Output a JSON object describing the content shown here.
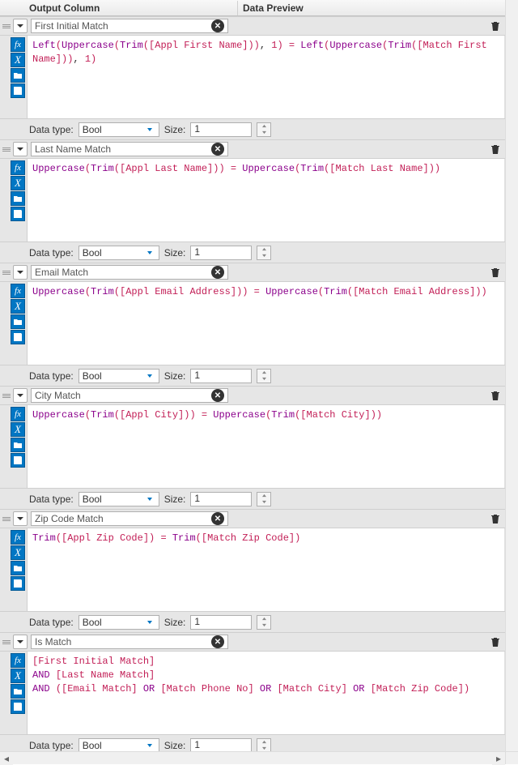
{
  "headers": {
    "output": "Output Column",
    "preview": "Data Preview"
  },
  "labels": {
    "data_type": "Data type:",
    "size": "Size:"
  },
  "rows": [
    {
      "name": "First Initial Match",
      "data_type": "Bool",
      "size": "1",
      "expression_plain": "Left(Uppercase(Trim([Appl First Name])), 1) = Left(Uppercase(Trim([Match First Name])), 1)",
      "expression_tokens": [
        {
          "t": "Left",
          "c": "tok-fn"
        },
        {
          "t": "(",
          "c": "tok-lit"
        },
        {
          "t": "Uppercase",
          "c": "tok-fn"
        },
        {
          "t": "(",
          "c": "tok-lit"
        },
        {
          "t": "Trim",
          "c": "tok-fn"
        },
        {
          "t": "(",
          "c": "tok-lit"
        },
        {
          "t": "[Appl First Name]",
          "c": "tok-field2"
        },
        {
          "t": ")",
          "c": "tok-lit"
        },
        {
          "t": ")",
          "c": "tok-lit"
        },
        {
          "t": ", ",
          "c": ""
        },
        {
          "t": "1",
          "c": "tok-lit"
        },
        {
          "t": ")",
          "c": "tok-lit"
        },
        {
          "t": " = ",
          "c": "tok-lit"
        },
        {
          "t": "Left",
          "c": "tok-fn"
        },
        {
          "t": "(",
          "c": "tok-lit"
        },
        {
          "t": "Uppercase",
          "c": "tok-fn"
        },
        {
          "t": "(",
          "c": "tok-lit"
        },
        {
          "t": "Trim",
          "c": "tok-fn"
        },
        {
          "t": "(",
          "c": "tok-lit"
        },
        {
          "t": "[Match First Name]",
          "c": "tok-field2"
        },
        {
          "t": ")",
          "c": "tok-lit"
        },
        {
          "t": ")",
          "c": "tok-lit"
        },
        {
          "t": ", ",
          "c": ""
        },
        {
          "t": "1",
          "c": "tok-lit"
        },
        {
          "t": ")",
          "c": "tok-lit"
        }
      ]
    },
    {
      "name": "Last Name Match",
      "data_type": "Bool",
      "size": "1",
      "expression_plain": "Uppercase(Trim([Appl Last Name])) = Uppercase(Trim([Match Last Name]))",
      "expression_tokens": [
        {
          "t": "Uppercase",
          "c": "tok-fn"
        },
        {
          "t": "(",
          "c": "tok-lit"
        },
        {
          "t": "Trim",
          "c": "tok-fn"
        },
        {
          "t": "(",
          "c": "tok-lit"
        },
        {
          "t": "[Appl Last Name]",
          "c": "tok-field2"
        },
        {
          "t": ")",
          "c": "tok-lit"
        },
        {
          "t": ")",
          "c": "tok-lit"
        },
        {
          "t": " = ",
          "c": "tok-lit"
        },
        {
          "t": "Uppercase",
          "c": "tok-fn"
        },
        {
          "t": "(",
          "c": "tok-lit"
        },
        {
          "t": "Trim",
          "c": "tok-fn"
        },
        {
          "t": "(",
          "c": "tok-lit"
        },
        {
          "t": "[Match Last Name]",
          "c": "tok-field2"
        },
        {
          "t": ")",
          "c": "tok-lit"
        },
        {
          "t": ")",
          "c": "tok-lit"
        }
      ]
    },
    {
      "name": "Email Match",
      "data_type": "Bool",
      "size": "1",
      "expression_plain": "Uppercase(Trim([Appl Email Address])) = Uppercase(Trim([Match Email Address]))",
      "expression_tokens": [
        {
          "t": "Uppercase",
          "c": "tok-fn"
        },
        {
          "t": "(",
          "c": "tok-lit"
        },
        {
          "t": "Trim",
          "c": "tok-fn"
        },
        {
          "t": "(",
          "c": "tok-lit"
        },
        {
          "t": "[Appl Email Address]",
          "c": "tok-field2"
        },
        {
          "t": ")",
          "c": "tok-lit"
        },
        {
          "t": ")",
          "c": "tok-lit"
        },
        {
          "t": " = ",
          "c": "tok-lit"
        },
        {
          "t": "Uppercase",
          "c": "tok-fn"
        },
        {
          "t": "(",
          "c": "tok-lit"
        },
        {
          "t": "Trim",
          "c": "tok-fn"
        },
        {
          "t": "(",
          "c": "tok-lit"
        },
        {
          "t": "[Match Email Address]",
          "c": "tok-field2"
        },
        {
          "t": ")",
          "c": "tok-lit"
        },
        {
          "t": ")",
          "c": "tok-lit"
        }
      ]
    },
    {
      "name": "City Match",
      "data_type": "Bool",
      "size": "1",
      "expression_plain": "Uppercase(Trim([Appl City])) = Uppercase(Trim([Match City]))",
      "expression_tokens": [
        {
          "t": "Uppercase",
          "c": "tok-fn"
        },
        {
          "t": "(",
          "c": "tok-lit"
        },
        {
          "t": "Trim",
          "c": "tok-fn"
        },
        {
          "t": "(",
          "c": "tok-lit"
        },
        {
          "t": "[Appl City]",
          "c": "tok-field2"
        },
        {
          "t": ")",
          "c": "tok-lit"
        },
        {
          "t": ")",
          "c": "tok-lit"
        },
        {
          "t": " = ",
          "c": "tok-lit"
        },
        {
          "t": "Uppercase",
          "c": "tok-fn"
        },
        {
          "t": "(",
          "c": "tok-lit"
        },
        {
          "t": "Trim",
          "c": "tok-fn"
        },
        {
          "t": "(",
          "c": "tok-lit"
        },
        {
          "t": "[Match City]",
          "c": "tok-field2"
        },
        {
          "t": ")",
          "c": "tok-lit"
        },
        {
          "t": ")",
          "c": "tok-lit"
        }
      ]
    },
    {
      "name": "Zip Code Match",
      "data_type": "Bool",
      "size": "1",
      "expression_plain": "Trim([Appl Zip Code]) = Trim([Match Zip Code])",
      "expression_tokens": [
        {
          "t": "Trim",
          "c": "tok-fn"
        },
        {
          "t": "(",
          "c": "tok-lit"
        },
        {
          "t": "[Appl Zip Code]",
          "c": "tok-field2"
        },
        {
          "t": ")",
          "c": "tok-lit"
        },
        {
          "t": " = ",
          "c": "tok-lit"
        },
        {
          "t": "Trim",
          "c": "tok-fn"
        },
        {
          "t": "(",
          "c": "tok-lit"
        },
        {
          "t": "[Match Zip Code]",
          "c": "tok-field2"
        },
        {
          "t": ")",
          "c": "tok-lit"
        }
      ]
    },
    {
      "name": "Is Match",
      "data_type": "Bool",
      "size": "1",
      "expression_plain": "[First Initial Match]\nAND [Last Name Match]\nAND ([Email Match] OR [Match Phone No] OR [Match City] OR [Match Zip Code])",
      "expression_tokens": [
        {
          "t": "[First Initial Match]",
          "c": "tok-field2"
        },
        {
          "t": "\n",
          "c": ""
        },
        {
          "t": "AND",
          "c": "tok-fn"
        },
        {
          "t": " ",
          "c": ""
        },
        {
          "t": "[Last Name Match]",
          "c": "tok-field2"
        },
        {
          "t": "\n",
          "c": ""
        },
        {
          "t": "AND",
          "c": "tok-fn"
        },
        {
          "t": " ",
          "c": ""
        },
        {
          "t": "(",
          "c": "tok-lit"
        },
        {
          "t": "[Email Match]",
          "c": "tok-field2"
        },
        {
          "t": " ",
          "c": ""
        },
        {
          "t": "OR",
          "c": "tok-fn"
        },
        {
          "t": " ",
          "c": ""
        },
        {
          "t": "[Match Phone No]",
          "c": "tok-field2"
        },
        {
          "t": " ",
          "c": ""
        },
        {
          "t": "OR",
          "c": "tok-fn"
        },
        {
          "t": " ",
          "c": ""
        },
        {
          "t": "[Match City]",
          "c": "tok-field2"
        },
        {
          "t": " ",
          "c": ""
        },
        {
          "t": "OR",
          "c": "tok-fn"
        },
        {
          "t": " ",
          "c": ""
        },
        {
          "t": "[Match Zip Code]",
          "c": "tok-field2"
        },
        {
          "t": ")",
          "c": "tok-lit"
        }
      ]
    }
  ]
}
